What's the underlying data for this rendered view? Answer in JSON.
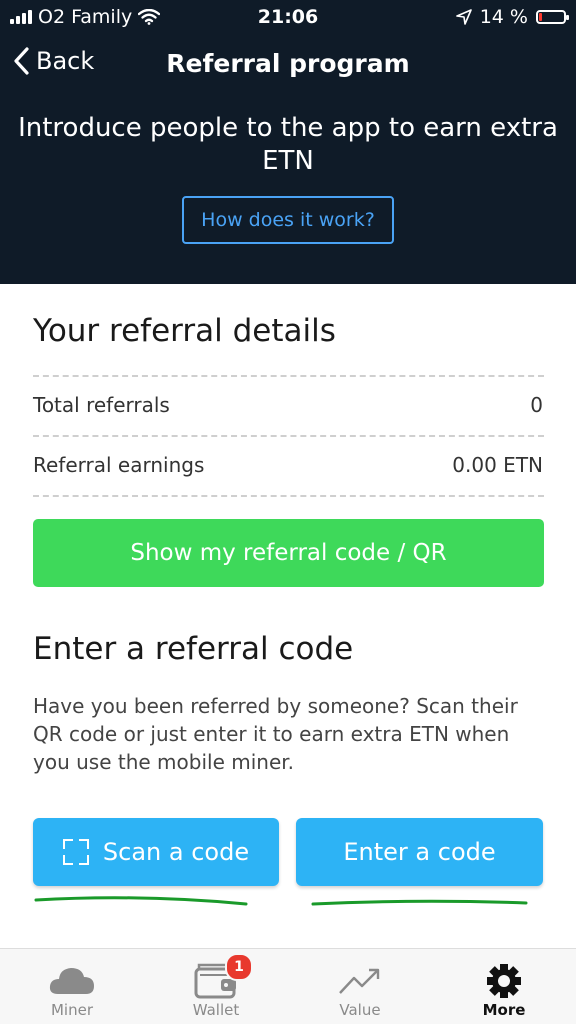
{
  "status_bar": {
    "carrier": "O2 Family",
    "time": "21:06",
    "battery": "14 %",
    "battery_level": 0.14,
    "battery_color": "#ff3b30"
  },
  "header": {
    "back_label": "Back",
    "title": "Referral program",
    "intro_line1": "Introduce people to the app to earn extra",
    "intro_line2": "ETN",
    "how_button": "How does it work?"
  },
  "details": {
    "title": "Your referral details",
    "rows": [
      {
        "label": "Total referrals",
        "value": "0"
      },
      {
        "label": "Referral earnings",
        "value": "0.00 ETN"
      }
    ],
    "show_code_button": "Show my referral code / QR"
  },
  "enter_code": {
    "title": "Enter a referral code",
    "description": "Have you been referred by someone? Scan their QR code or just enter it to earn extra ETN when you use the mobile miner.",
    "scan_button": "Scan a code",
    "enter_button": "Enter a code"
  },
  "tab_bar": {
    "items": [
      {
        "label": "Miner",
        "icon": "cloud-icon"
      },
      {
        "label": "Wallet",
        "icon": "wallet-icon",
        "badge": "1"
      },
      {
        "label": "Value",
        "icon": "trend-up-icon"
      },
      {
        "label": "More",
        "icon": "gear-icon"
      }
    ],
    "active": "More"
  },
  "colors": {
    "header_bg": "#0f1b28",
    "accent_blue": "#4aa3f5",
    "green_button": "#3ed95a",
    "blue_button": "#2db3f5",
    "badge_red": "#e8392e",
    "annotation_green": "#1a9a2a"
  }
}
